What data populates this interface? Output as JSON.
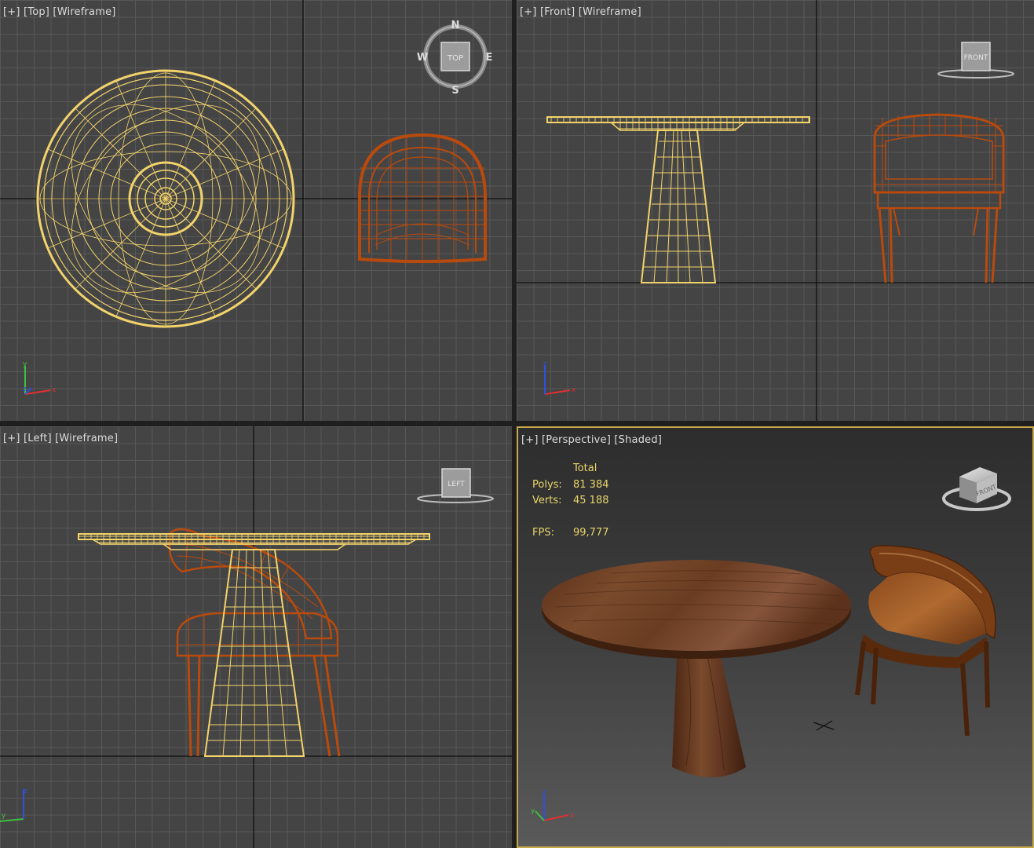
{
  "viewports": {
    "top": {
      "label_plus": "[+]",
      "label_view": "[Top]",
      "label_mode": "[Wireframe]",
      "viewcube": "TOP",
      "compass": {
        "n": "N",
        "s": "S",
        "e": "E",
        "w": "W"
      }
    },
    "front": {
      "label_plus": "[+]",
      "label_view": "[Front]",
      "label_mode": "[Wireframe]",
      "viewcube": "FRONT"
    },
    "left": {
      "label_plus": "[+]",
      "label_view": "[Left]",
      "label_mode": "[Wireframe]",
      "viewcube": "LEFT"
    },
    "perspective": {
      "label_plus": "[+]",
      "label_view": "[Perspective]",
      "label_mode": "[Shaded]",
      "viewcube": "FRONT",
      "stats": {
        "header": "Total",
        "polys_label": "Polys:",
        "polys_value": "81 384",
        "verts_label": "Verts:",
        "verts_value": "45 188",
        "fps_label": "FPS:",
        "fps_value": "99,777"
      }
    }
  },
  "axis_labels": {
    "x": "x",
    "y": "y",
    "z": "z"
  },
  "colors": {
    "table_wire": "#f2d36b",
    "chair_wire": "#b84a0e",
    "active_border": "#c8a94a",
    "stats_text": "#e8d56a",
    "axis_x": "#e03030",
    "axis_y": "#40c040",
    "axis_z": "#3050e0"
  }
}
